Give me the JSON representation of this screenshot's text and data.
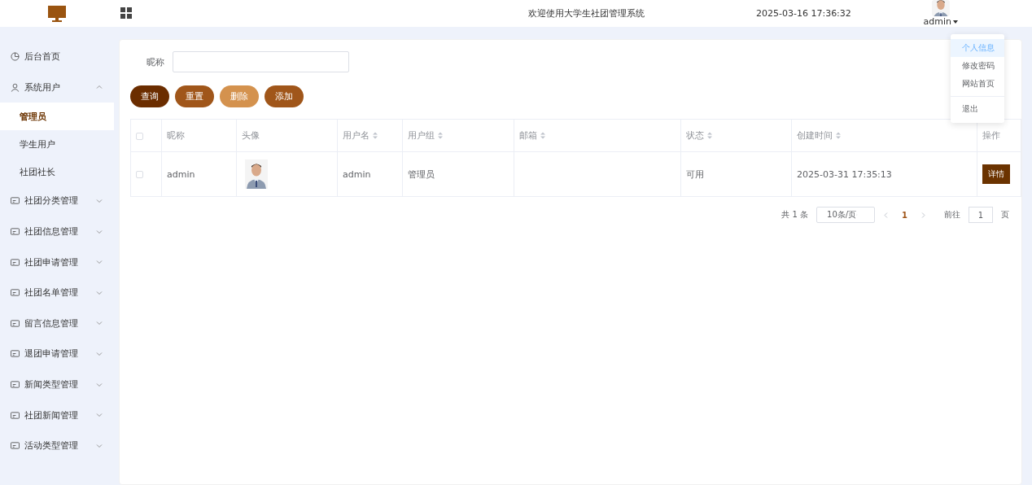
{
  "header": {
    "title": "欢迎使用大学生社团管理系统",
    "datetime": "2025-03-16 17:36:32",
    "user": "admin"
  },
  "user_menu": [
    {
      "label": "个人信息",
      "selected": true
    },
    {
      "label": "修改密码",
      "selected": false
    },
    {
      "label": "网站首页",
      "selected": false
    },
    {
      "label": "退出",
      "selected": false
    }
  ],
  "sidebar": {
    "items": [
      {
        "label": "后台首页",
        "kind": "clock"
      },
      {
        "label": "系统用户",
        "kind": "user",
        "expanded": true,
        "children": [
          {
            "label": "管理员",
            "selected": true
          },
          {
            "label": "学生用户",
            "selected": false
          },
          {
            "label": "社团社长",
            "selected": false
          }
        ]
      },
      {
        "label": "社团分类管理",
        "kind": "card",
        "expanded": false
      },
      {
        "label": "社团信息管理",
        "kind": "card",
        "expanded": false
      },
      {
        "label": "社团申请管理",
        "kind": "card",
        "expanded": false
      },
      {
        "label": "社团名单管理",
        "kind": "card",
        "expanded": false
      },
      {
        "label": "留言信息管理",
        "kind": "card",
        "expanded": false
      },
      {
        "label": "退团申请管理",
        "kind": "card",
        "expanded": false
      },
      {
        "label": "新闻类型管理",
        "kind": "card",
        "expanded": false
      },
      {
        "label": "社团新闻管理",
        "kind": "card",
        "expanded": false
      },
      {
        "label": "活动类型管理",
        "kind": "card",
        "expanded": false
      }
    ]
  },
  "search": {
    "label": "昵称"
  },
  "buttons": [
    {
      "label": "查询",
      "kind": "query",
      "disabled": false
    },
    {
      "label": "重置",
      "kind": "reset",
      "disabled": false
    },
    {
      "label": "删除",
      "kind": "delete",
      "disabled": true
    },
    {
      "label": "添加",
      "kind": "add",
      "disabled": false
    }
  ],
  "table": {
    "columns": [
      {
        "label": "昵称",
        "sortable": false
      },
      {
        "label": "头像",
        "sortable": false
      },
      {
        "label": "用户名",
        "sortable": true
      },
      {
        "label": "用户组",
        "sortable": true
      },
      {
        "label": "邮箱",
        "sortable": true
      },
      {
        "label": "状态",
        "sortable": true
      },
      {
        "label": "创建时间",
        "sortable": true
      },
      {
        "label": "操作",
        "sortable": false
      }
    ],
    "header_checked": false,
    "rows": [
      {
        "checked": false,
        "nickname": "admin",
        "username": "admin",
        "group": "管理员",
        "status": "可用",
        "created": "2025-03-31 17:35:13",
        "action": "详情"
      }
    ]
  },
  "pagination": {
    "total": "共 1 条",
    "page_size": "10条/页",
    "pages": [
      {
        "label": "1",
        "selected": true
      }
    ],
    "goto_label": "前往",
    "goto_value": "1",
    "suffix": "页"
  }
}
